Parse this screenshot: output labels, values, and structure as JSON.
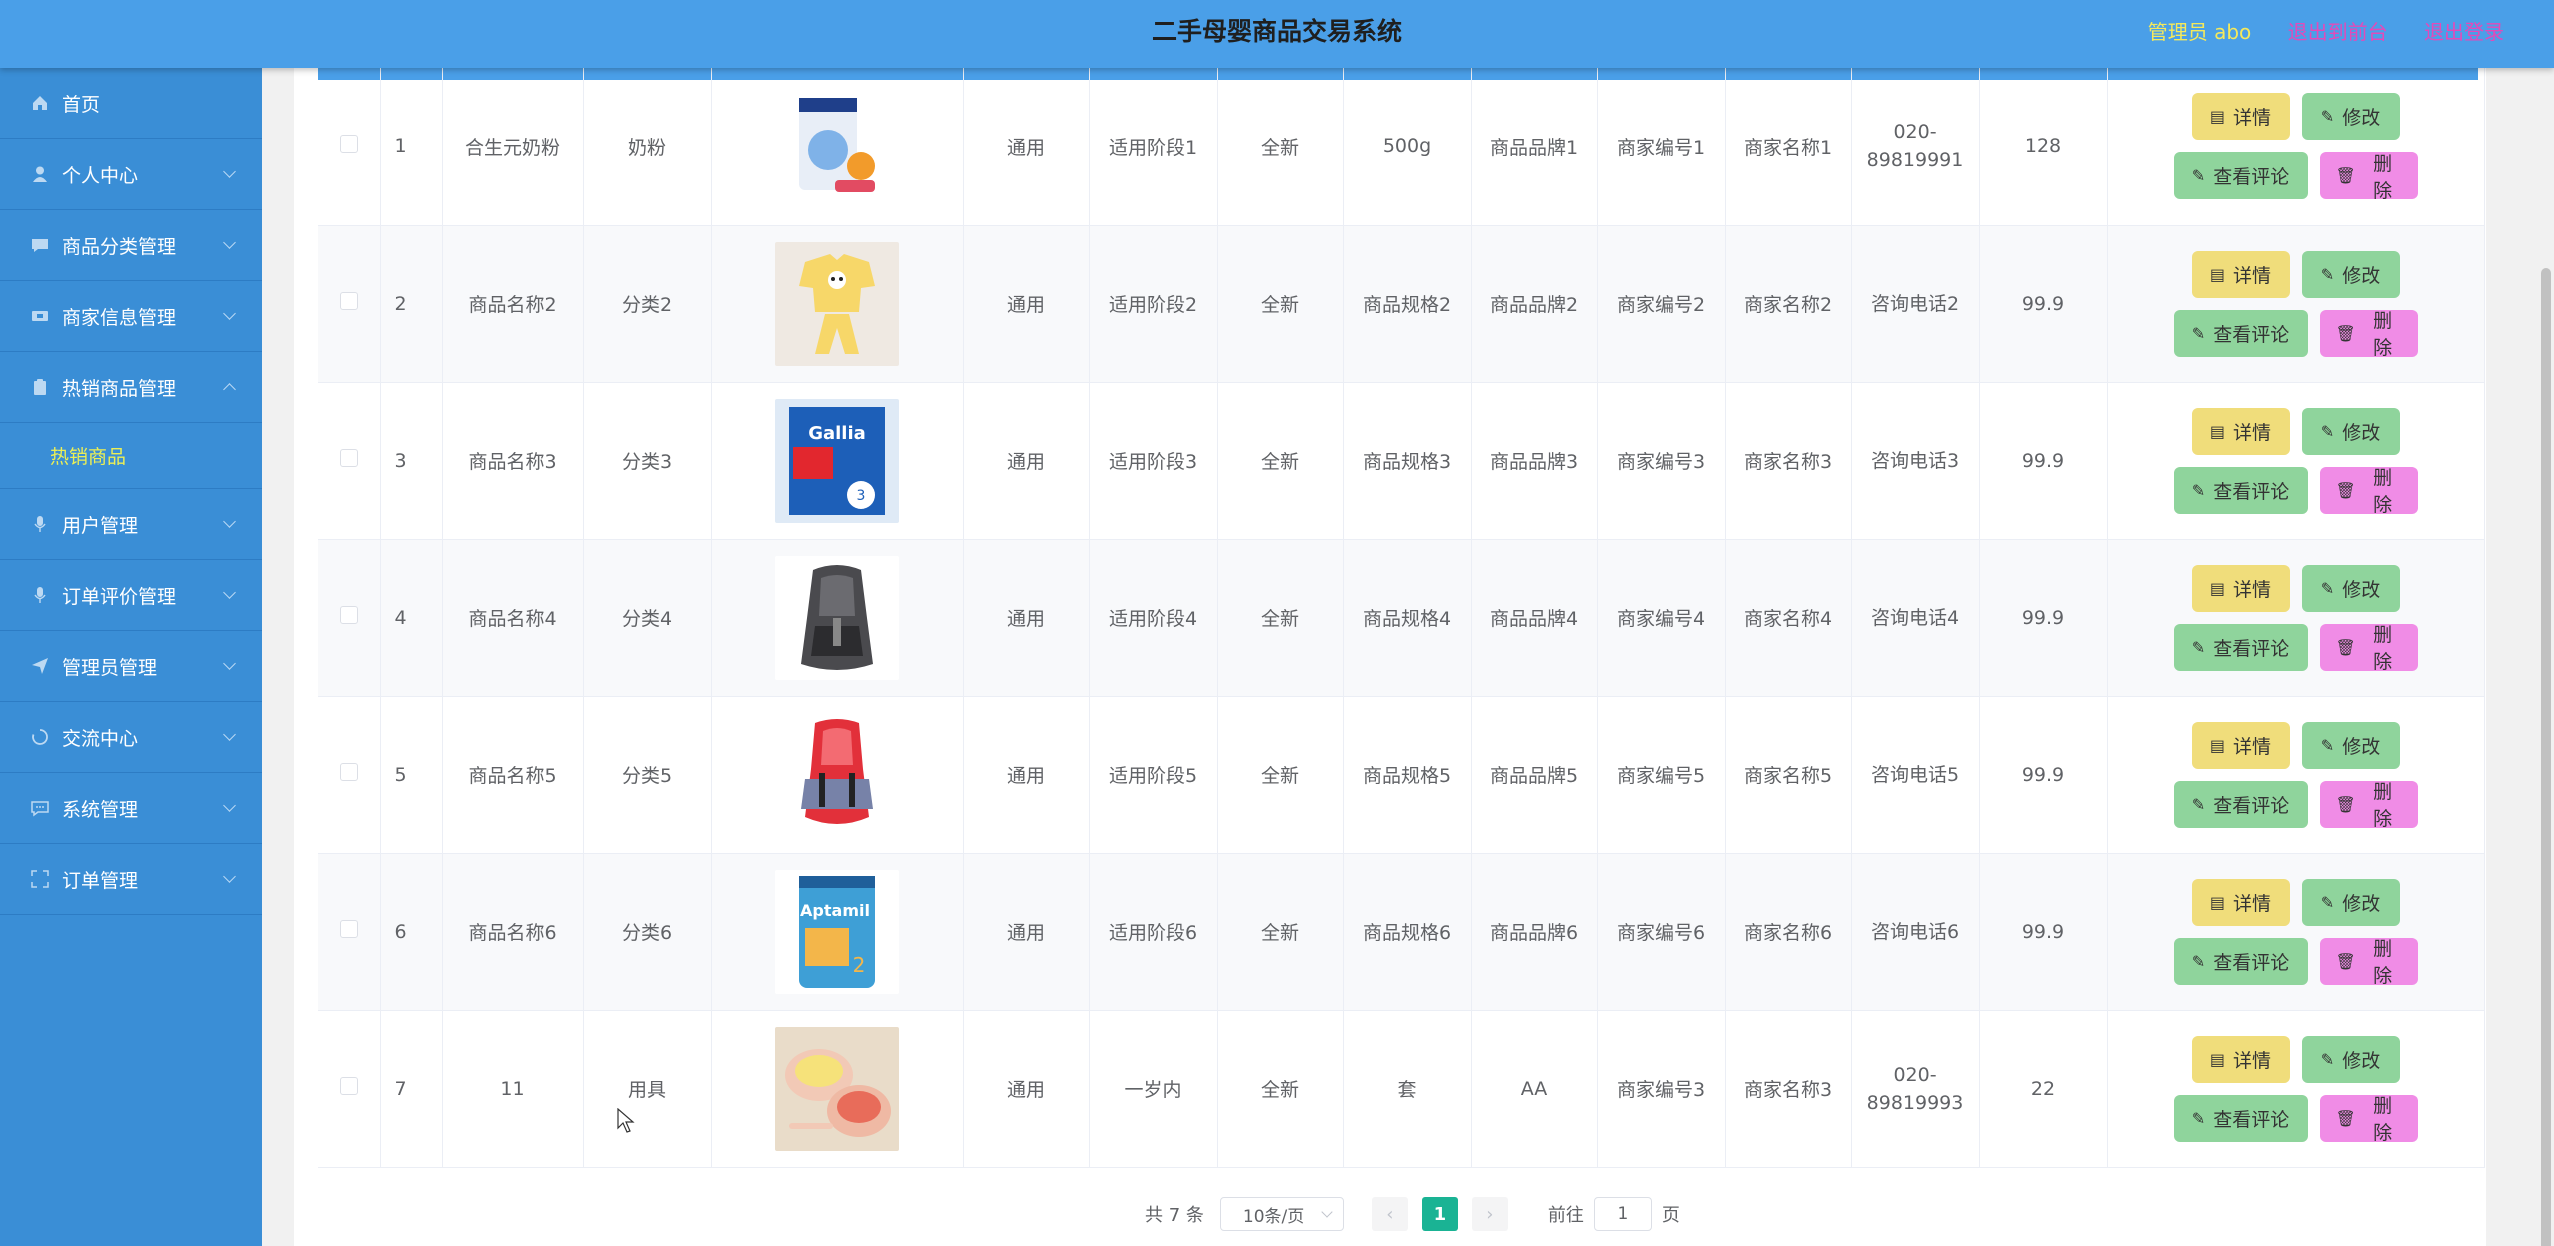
{
  "header": {
    "title": "二手母婴商品交易系统",
    "user": "管理员 abo",
    "back_to_front": "退出到前台",
    "logout": "退出登录"
  },
  "sidebar": {
    "items": [
      {
        "label": "首页",
        "icon": "home-icon",
        "expandable": false
      },
      {
        "label": "个人中心",
        "icon": "user-icon",
        "expandable": true
      },
      {
        "label": "商品分类管理",
        "icon": "message-icon",
        "expandable": true
      },
      {
        "label": "商家信息管理",
        "icon": "ticket-icon",
        "expandable": true
      },
      {
        "label": "热销商品管理",
        "icon": "clipboard-icon",
        "expandable": true,
        "expanded": true
      },
      {
        "label": "用户管理",
        "icon": "microphone-icon",
        "expandable": true
      },
      {
        "label": "订单评价管理",
        "icon": "microphone-icon",
        "expandable": true
      },
      {
        "label": "管理员管理",
        "icon": "send-icon",
        "expandable": true
      },
      {
        "label": "交流中心",
        "icon": "loading-icon",
        "expandable": true
      },
      {
        "label": "系统管理",
        "icon": "chat-icon",
        "expandable": true
      },
      {
        "label": "订单管理",
        "icon": "fullscreen-icon",
        "expandable": true
      }
    ],
    "subitem": "热销商品"
  },
  "table": {
    "rows": [
      {
        "index": "1",
        "name": "合生元奶粉",
        "category": "奶粉",
        "image": "milk-powder-can",
        "gender": "通用",
        "stage": "适用阶段1",
        "condition": "全新",
        "spec": "500g",
        "brand": "商品品牌1",
        "merchant_no": "商家编号1",
        "merchant_name": "商家名称1",
        "phone": "020-89819991",
        "price": "128"
      },
      {
        "index": "2",
        "name": "商品名称2",
        "category": "分类2",
        "image": "baby-clothes",
        "gender": "通用",
        "stage": "适用阶段2",
        "condition": "全新",
        "spec": "商品规格2",
        "brand": "商品品牌2",
        "merchant_no": "商家编号2",
        "merchant_name": "商家名称2",
        "phone": "咨询电话2",
        "price": "99.9"
      },
      {
        "index": "3",
        "name": "商品名称3",
        "category": "分类3",
        "image": "gallia-milk-box",
        "gender": "通用",
        "stage": "适用阶段3",
        "condition": "全新",
        "spec": "商品规格3",
        "brand": "商品品牌3",
        "merchant_no": "商家编号3",
        "merchant_name": "商家名称3",
        "phone": "咨询电话3",
        "price": "99.9"
      },
      {
        "index": "4",
        "name": "商品名称4",
        "category": "分类4",
        "image": "car-seat-gray",
        "gender": "通用",
        "stage": "适用阶段4",
        "condition": "全新",
        "spec": "商品规格4",
        "brand": "商品品牌4",
        "merchant_no": "商家编号4",
        "merchant_name": "商家名称4",
        "phone": "咨询电话4",
        "price": "99.9"
      },
      {
        "index": "5",
        "name": "商品名称5",
        "category": "分类5",
        "image": "car-seat-red",
        "gender": "通用",
        "stage": "适用阶段5",
        "condition": "全新",
        "spec": "商品规格5",
        "brand": "商品品牌5",
        "merchant_no": "商家编号5",
        "merchant_name": "商家名称5",
        "phone": "咨询电话5",
        "price": "99.9"
      },
      {
        "index": "6",
        "name": "商品名称6",
        "category": "分类6",
        "image": "aptamil-can",
        "gender": "通用",
        "stage": "适用阶段6",
        "condition": "全新",
        "spec": "商品规格6",
        "brand": "商品品牌6",
        "merchant_no": "商家编号6",
        "merchant_name": "商家名称6",
        "phone": "咨询电话6",
        "price": "99.9"
      },
      {
        "index": "7",
        "name": "11",
        "category": "用具",
        "image": "baby-tableware",
        "gender": "通用",
        "stage": "一岁内",
        "condition": "全新",
        "spec": "套",
        "brand": "AA",
        "merchant_no": "商家编号3",
        "merchant_name": "商家名称3",
        "phone": "020-89819993",
        "price": "22"
      }
    ],
    "actions": {
      "detail": "详情",
      "edit": "修改",
      "comment": "查看评论",
      "delete": "删除"
    }
  },
  "pagination": {
    "total": "共 7 条",
    "page_size": "10条/页",
    "current_page": "1",
    "goto_label": "前往",
    "goto_value": "1",
    "page_unit": "页"
  }
}
